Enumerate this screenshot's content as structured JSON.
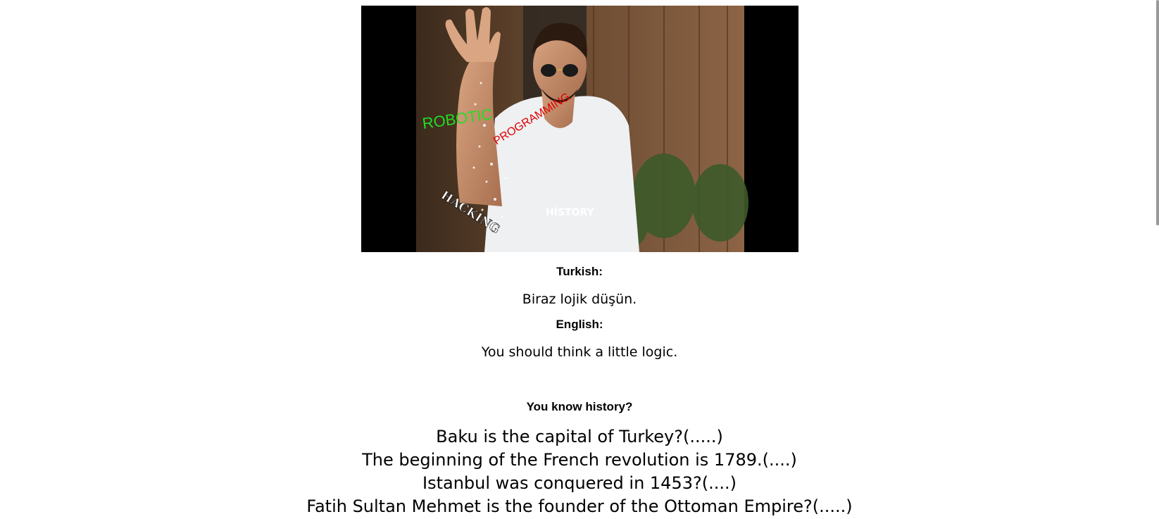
{
  "image": {
    "overlay_words": {
      "robotic": "ROBOTIC",
      "programming": "PROGRAMMING",
      "hacking": "HACKING",
      "history": "HİSTORY"
    },
    "colors": {
      "robotic": "#22dd22",
      "programming": "#e00000",
      "hacking": "#ffffff",
      "history": "#ffffff"
    }
  },
  "turkish": {
    "heading": "Turkish:",
    "text": "Biraz lojik düşün."
  },
  "english": {
    "heading": "English:",
    "text": "You should think a little logic."
  },
  "quiz": {
    "heading": "You know history?",
    "questions": [
      "Baku is the capital of Turkey?(.....)",
      "The beginning of the French revolution is 1789.(....)",
      "Istanbul was conquered in 1453?(....)",
      "Fatih Sultan Mehmet is the founder of the Ottoman Empire?(.....)"
    ]
  }
}
